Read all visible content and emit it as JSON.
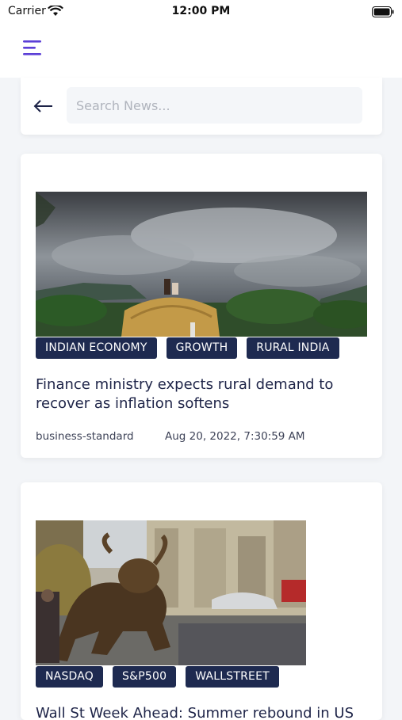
{
  "status_bar": {
    "carrier": "Carrier",
    "time": "12:00 PM"
  },
  "header": {
    "menu_icon": "hamburger-menu-icon"
  },
  "search": {
    "back_icon": "arrow-left-icon",
    "placeholder": "Search News..."
  },
  "articles": [
    {
      "tags": [
        "INDIAN ECONOMY",
        "GROWTH",
        "RURAL INDIA"
      ],
      "title": "Finance ministry expects rural demand to recover as inflation softens",
      "source": "business-standard",
      "date": "Aug 20, 2022, 7:30:59 AM"
    },
    {
      "tags": [
        "NASDAQ",
        "S&P500",
        "WALLSTREET"
      ],
      "title": "Wall St Week Ahead: Summer rebound in US"
    }
  ],
  "colors": {
    "accent": "#5b3fd6",
    "tag_bg": "#1e2a50",
    "title_text": "#1e2448",
    "background": "#f3f5f8"
  }
}
